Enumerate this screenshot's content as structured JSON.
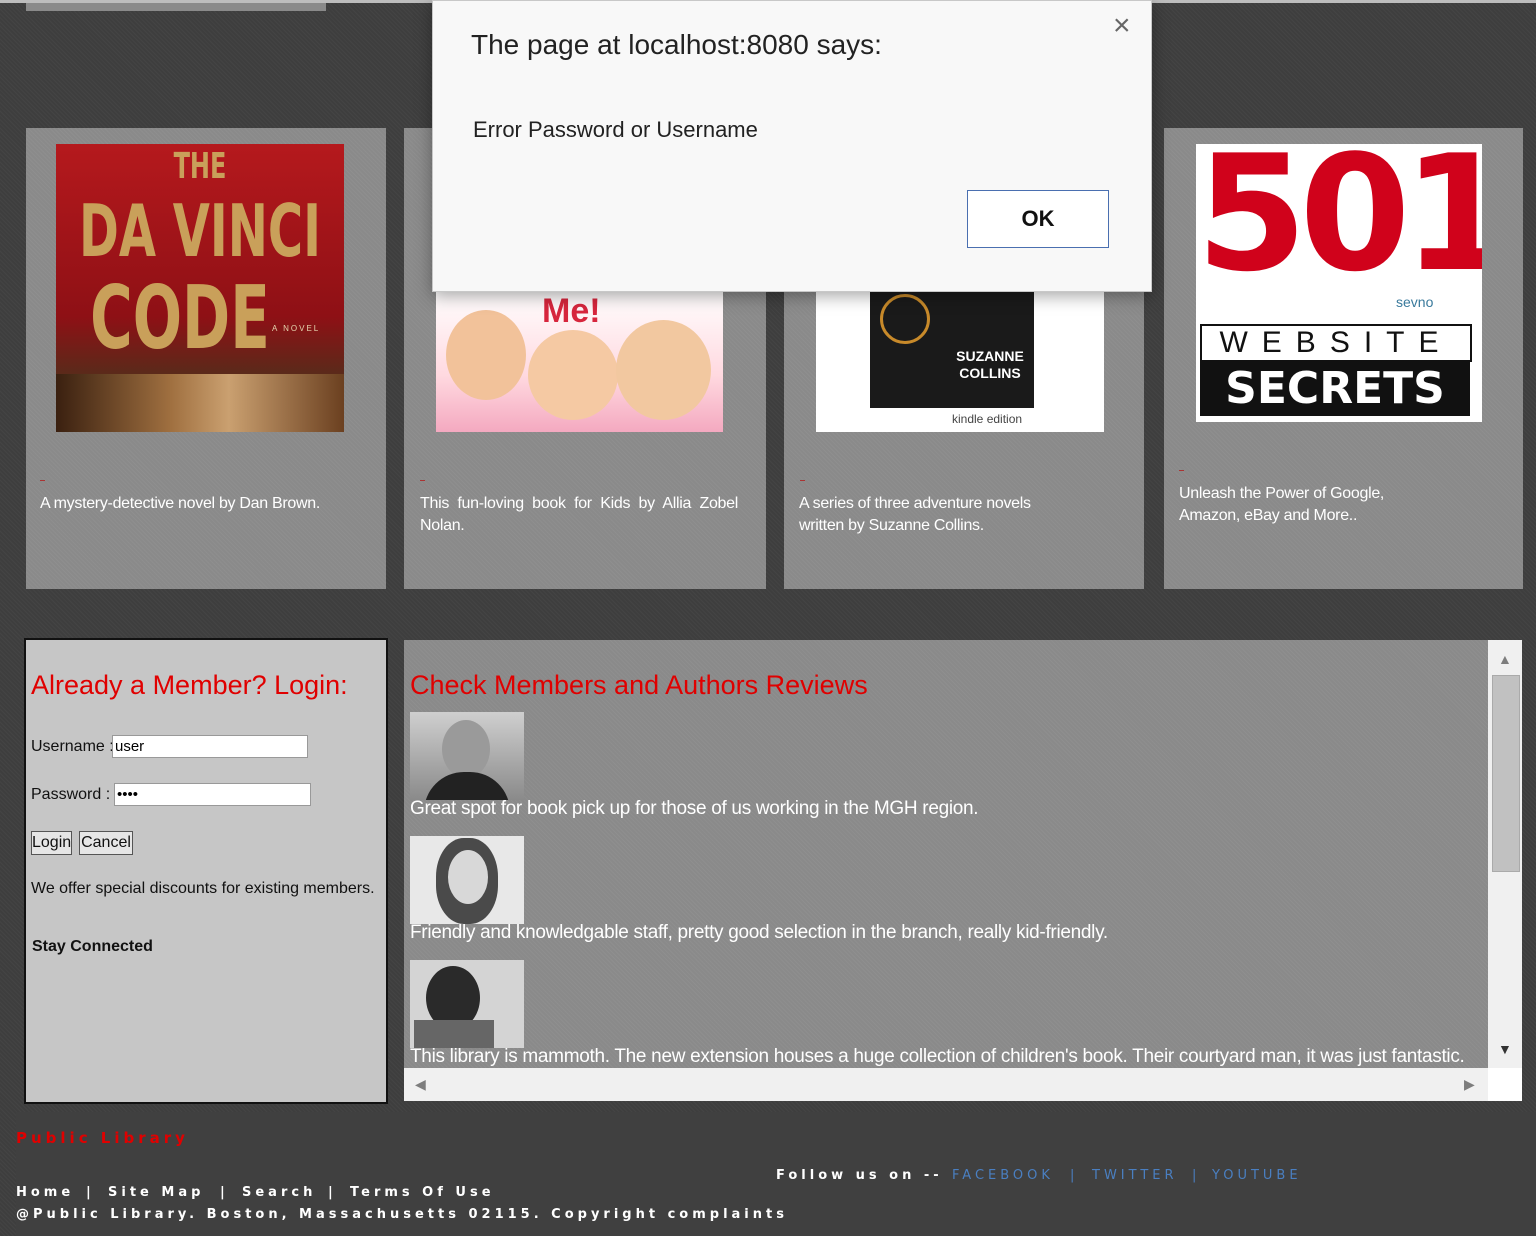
{
  "dialog": {
    "title": "The page at localhost:8080 says:",
    "message": "Error Password or Username",
    "ok_label": "OK",
    "close_glyph": "×"
  },
  "books": [
    {
      "description": "A mystery-detective novel by Dan Brown.",
      "cover_lines": [
        "THE",
        "DA VINCI",
        "CODE"
      ],
      "cover_subtitle": "A NOVEL"
    },
    {
      "description": "This fun-loving book for Kids by Allia Zobel Nolan.",
      "cover_text": "Me!"
    },
    {
      "description": "A series of three adventure novels written by Suzanne Collins.",
      "cover_author": [
        "SUZANNE",
        "COLLINS"
      ],
      "cover_badge": "kindle edition"
    },
    {
      "description": "Unleash the Power of Google, Amazon, eBay and More..",
      "cover_number": "501",
      "cover_line2": "WEBSITE",
      "cover_line3": "SECRETS",
      "cover_brand": "sevno"
    }
  ],
  "login": {
    "heading": "Already a Member? Login:",
    "username_label": "Username :",
    "username_value": "user",
    "password_label": "Password :",
    "password_value": "••••",
    "login_button": "Login",
    "cancel_button": "Cancel",
    "discount_text": "We offer special discounts for existing members.",
    "stay_connected": "Stay Connected"
  },
  "reviews": {
    "heading": "Check Members and Authors Reviews",
    "items": [
      {
        "text": "Great spot for book pick up for those of us working in the MGH region."
      },
      {
        "text": "Friendly and knowledgable staff, pretty good selection in the branch, really kid-friendly."
      },
      {
        "text": "This library is mammoth. The new extension houses a huge collection of children's book. Their courtyard man, it was just fantastic."
      }
    ]
  },
  "footer": {
    "brand": "Public Library",
    "follow_label": "Follow us on --",
    "social": [
      "FACEBOOK",
      "|",
      "TWITTER",
      "|",
      "YOUTUBE"
    ],
    "nav": [
      "Home",
      "|",
      "Site Map",
      "|",
      "Search",
      "|",
      "Terms Of Use"
    ],
    "copyright": "@Public Library. Boston, Massachusetts 02115. Copyright complaints"
  },
  "colors": {
    "heading_red": "#e00000",
    "link_blue": "#4a7fc1",
    "background": "#3e3e3e",
    "card_gray": "#8a8a8a"
  }
}
